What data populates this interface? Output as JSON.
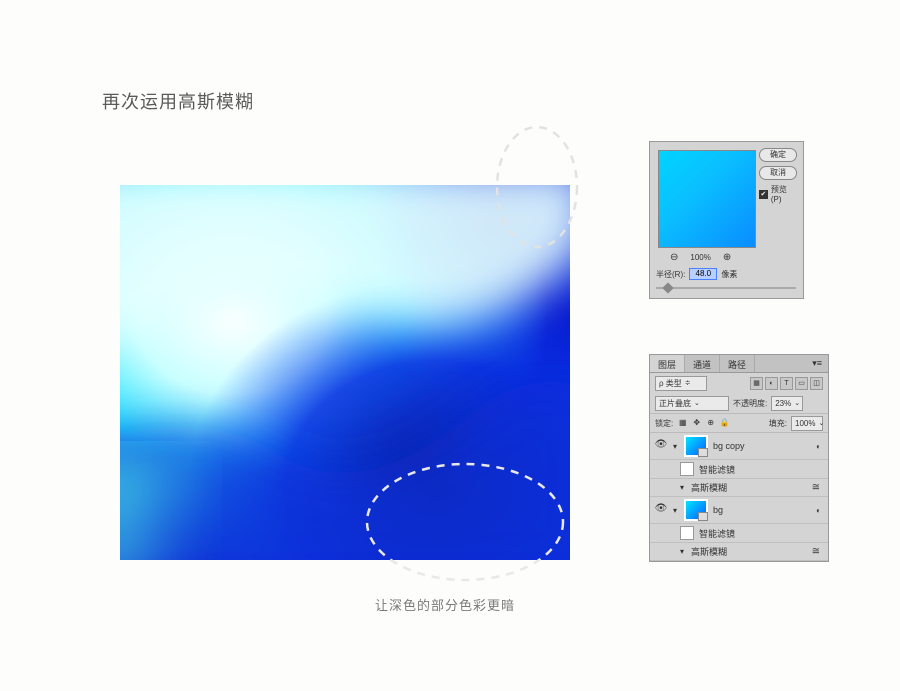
{
  "title": "再次运用高斯模糊",
  "caption": "让深色的部分色彩更暗",
  "dialog": {
    "ok": "确定",
    "cancel": "取消",
    "preview_label": "预览(P)",
    "preview_checked": true,
    "zoom_percent": "100%",
    "radius_label": "半径(R):",
    "radius_value": "48.0",
    "radius_unit": "像素"
  },
  "panel": {
    "tabs": [
      "图层",
      "通道",
      "路径"
    ],
    "active_tab": 0,
    "kind_label": "ρ 类型",
    "blend_mode": "正片叠底",
    "opacity_label": "不透明度:",
    "opacity_value": "23%",
    "lock_label": "锁定:",
    "fill_label": "填充:",
    "fill_value": "100%",
    "layers": [
      {
        "name": "bg copy",
        "visible": true,
        "smart_filters_label": "智能滤镜",
        "filter_name": "高斯模糊"
      },
      {
        "name": "bg",
        "visible": true,
        "smart_filters_label": "智能滤镜",
        "filter_name": "高斯模糊"
      }
    ]
  }
}
